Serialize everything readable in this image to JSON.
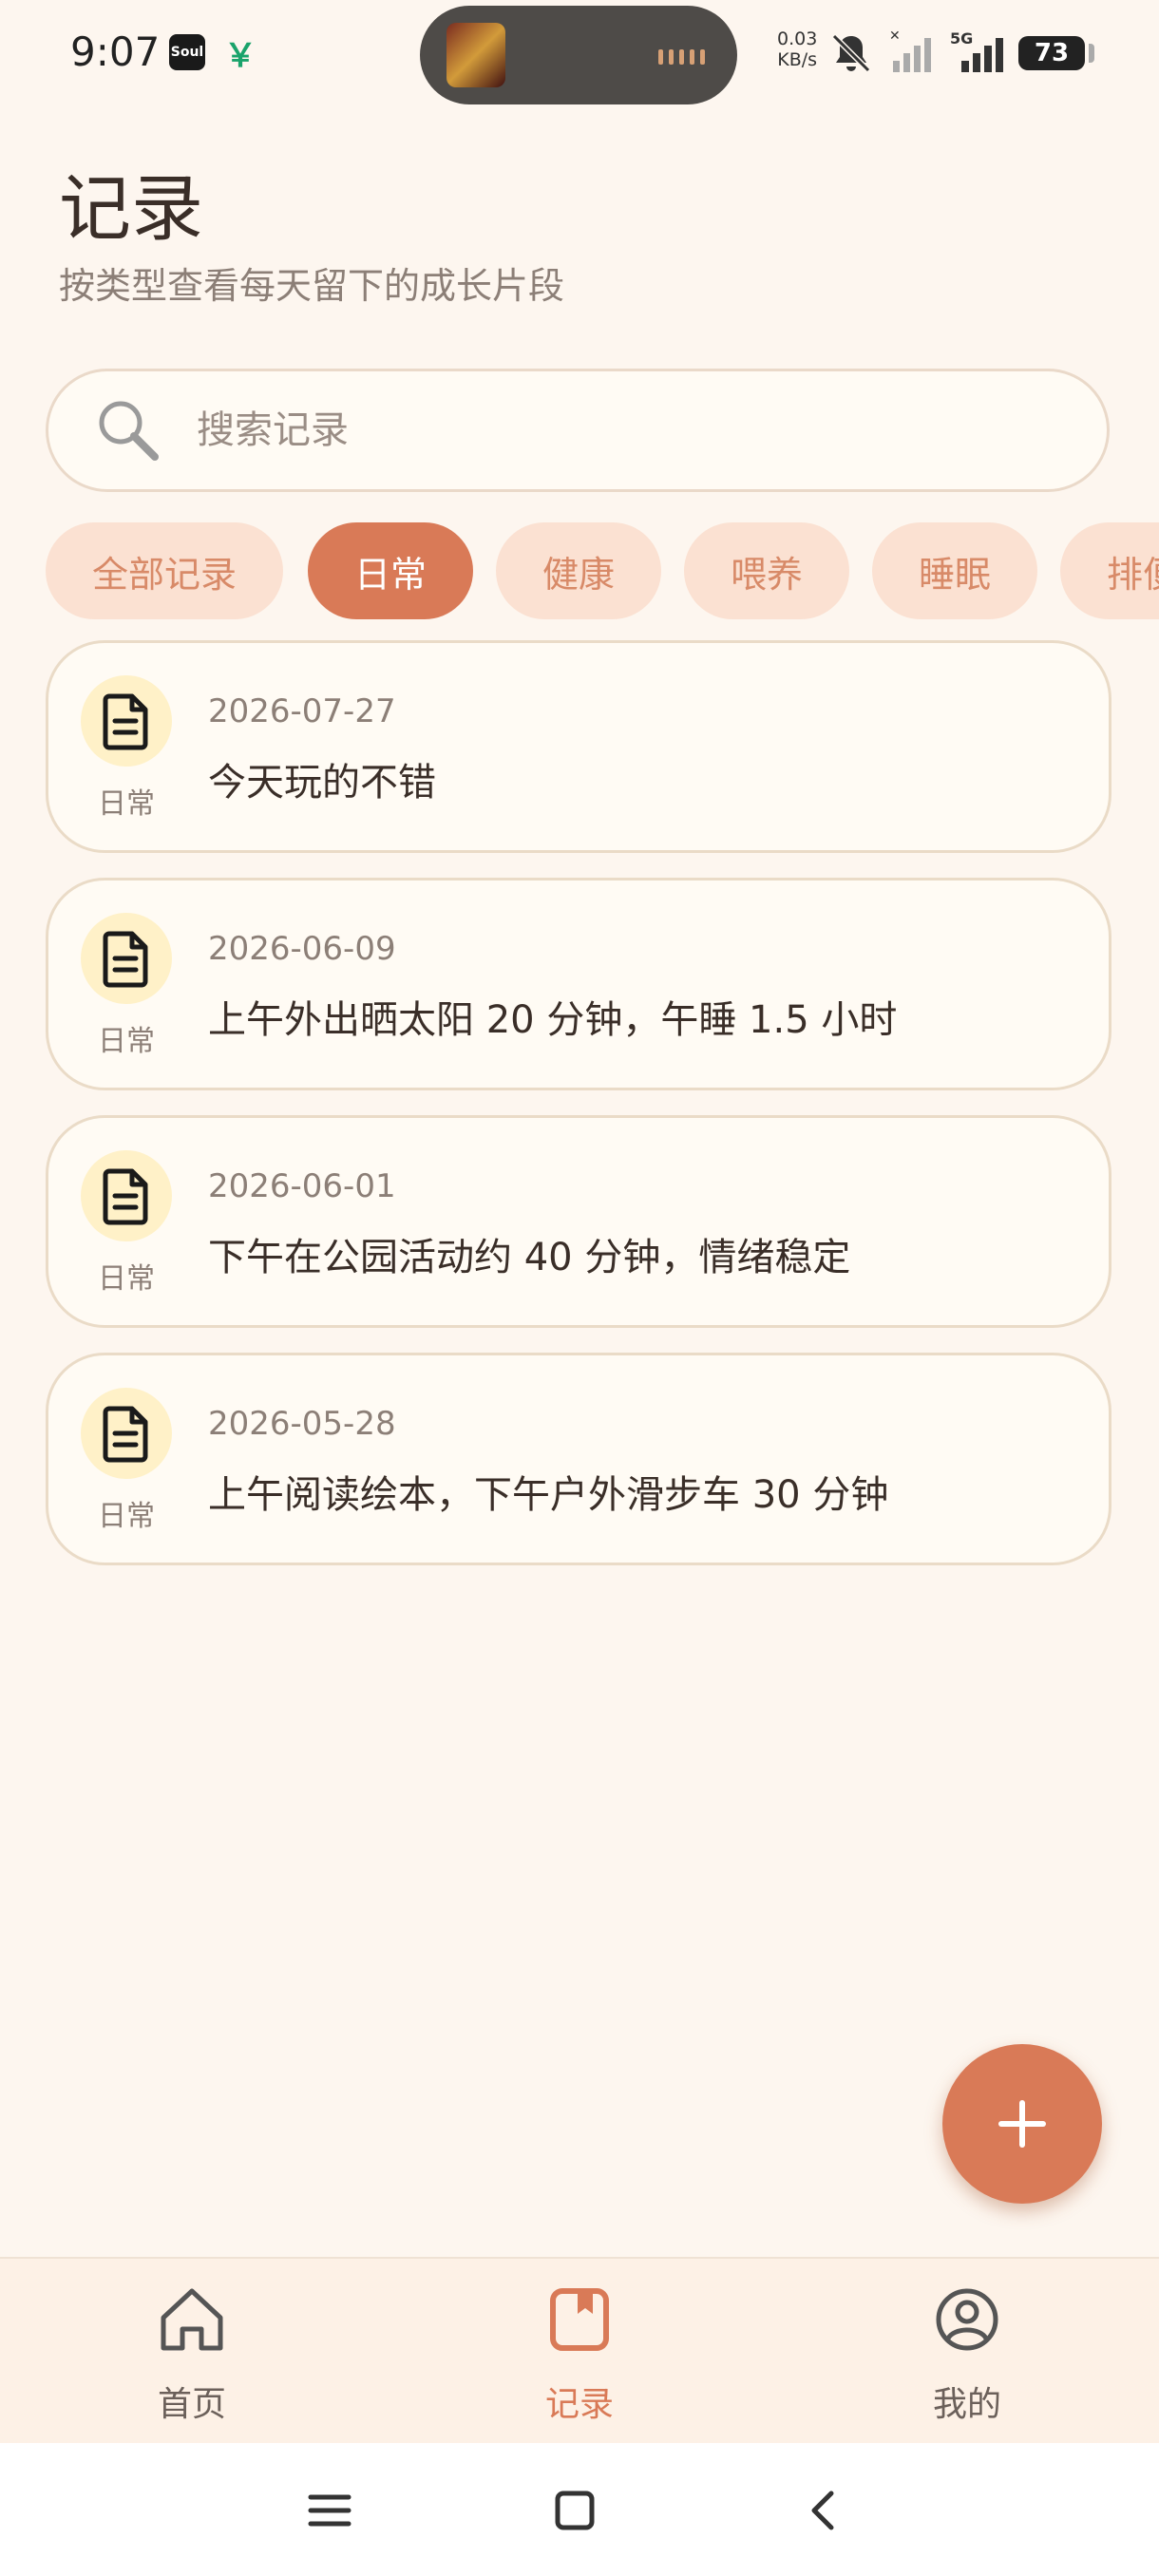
{
  "status_bar": {
    "time": "9:07",
    "app_icons": [
      "Soul",
      "￥"
    ],
    "net_speed_value": "0.03",
    "net_speed_unit": "KB/s",
    "network_type": "5G",
    "battery": "73",
    "icons": [
      "mute-icon",
      "signal-icon",
      "signal-5g-icon",
      "battery-icon"
    ]
  },
  "header": {
    "title": "记录",
    "subtitle": "按类型查看每天留下的成长片段"
  },
  "search": {
    "placeholder": "搜索记录",
    "value": ""
  },
  "filters": [
    {
      "label": "全部记录",
      "active": false
    },
    {
      "label": "日常",
      "active": true
    },
    {
      "label": "健康",
      "active": false
    },
    {
      "label": "喂养",
      "active": false
    },
    {
      "label": "睡眠",
      "active": false
    },
    {
      "label": "排便",
      "active": false
    }
  ],
  "records": [
    {
      "category": "日常",
      "date": "2026-07-27",
      "text": "今天玩的不错",
      "icon": "document-icon"
    },
    {
      "category": "日常",
      "date": "2026-06-09",
      "text": "上午外出晒太阳 20 分钟，午睡 1.5 小时",
      "icon": "document-icon"
    },
    {
      "category": "日常",
      "date": "2026-06-01",
      "text": "下午在公园活动约 40 分钟，情绪稳定",
      "icon": "document-icon"
    },
    {
      "category": "日常",
      "date": "2026-05-28",
      "text": "上午阅读绘本，下午户外滑步车 30 分钟",
      "icon": "document-icon"
    }
  ],
  "fab": {
    "icon": "plus-icon"
  },
  "bottom_nav": [
    {
      "label": "首页",
      "icon": "home-icon",
      "active": false
    },
    {
      "label": "记录",
      "icon": "book-icon",
      "active": true
    },
    {
      "label": "我的",
      "icon": "profile-icon",
      "active": false
    }
  ],
  "system_nav": [
    "menu-icon",
    "home-square-icon",
    "back-icon"
  ],
  "colors": {
    "background": "#fdf6ef",
    "accent": "#d97a57",
    "chip_bg": "#fbe1d2",
    "card_bg": "#fffbf4",
    "card_border": "#eadbc7",
    "doc_circle": "#fff1c8"
  }
}
